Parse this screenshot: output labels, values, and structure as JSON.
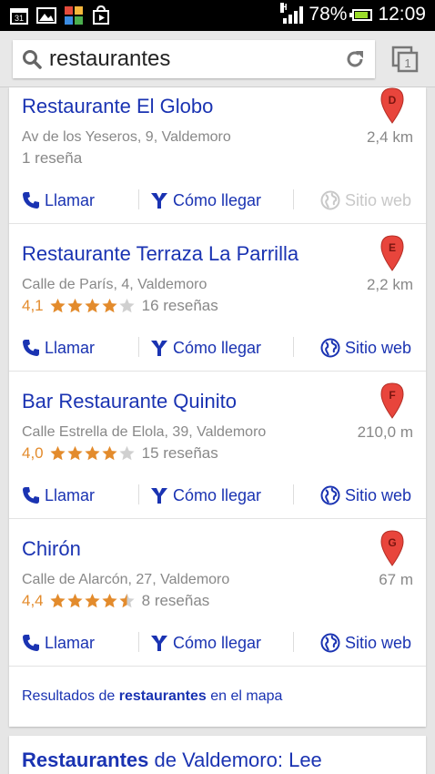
{
  "status_bar": {
    "network_type": "H",
    "battery_percent": "78%",
    "time": "12:09",
    "notification_icons": [
      "calendar-icon",
      "gallery-icon",
      "app-grid-icon",
      "play-store-icon"
    ],
    "calendar_day": "31"
  },
  "search": {
    "query": "restaurantes"
  },
  "listings": [
    {
      "name": "Restaurante El Globo",
      "address": "Av de los Yeseros, 9, Valdemoro",
      "distance": "2,4 km",
      "marker": "D",
      "rating": null,
      "stars": 0,
      "reviews": "1 reseña",
      "actions": {
        "call": "Llamar",
        "directions": "Cómo llegar",
        "website": "Sitio web"
      },
      "website_enabled": false
    },
    {
      "name": "Restaurante Terraza La Parrilla",
      "address": "Calle de París, 4, Valdemoro",
      "distance": "2,2 km",
      "marker": "E",
      "rating": "4,1",
      "stars": 4.0,
      "reviews": "16 reseñas",
      "actions": {
        "call": "Llamar",
        "directions": "Cómo llegar",
        "website": "Sitio web"
      },
      "website_enabled": true
    },
    {
      "name": "Bar Restaurante Quinito",
      "address": "Calle Estrella de Elola, 39, Valdemoro",
      "distance": "210,0 m",
      "marker": "F",
      "rating": "4,0",
      "stars": 4.0,
      "reviews": "15 reseñas",
      "actions": {
        "call": "Llamar",
        "directions": "Cómo llegar",
        "website": "Sitio web"
      },
      "website_enabled": true
    },
    {
      "name": "Chirón",
      "address": "Calle de Alarcón, 27, Valdemoro",
      "distance": "67 m",
      "marker": "G",
      "rating": "4,4",
      "stars": 4.5,
      "reviews": "8 reseñas",
      "actions": {
        "call": "Llamar",
        "directions": "Cómo llegar",
        "website": "Sitio web"
      },
      "website_enabled": true
    }
  ],
  "map_link": {
    "prefix": "Resultados de",
    "keyword": "restaurantes",
    "suffix": "en el mapa"
  },
  "next_result": {
    "title_bold": "Restaurantes",
    "title_rest": "de Valdemoro: Lee"
  },
  "colors": {
    "link_blue": "#1a33b2",
    "rating_orange": "#e38b2c",
    "marker_red": "#e8453c",
    "secondary_gray": "#888888"
  }
}
